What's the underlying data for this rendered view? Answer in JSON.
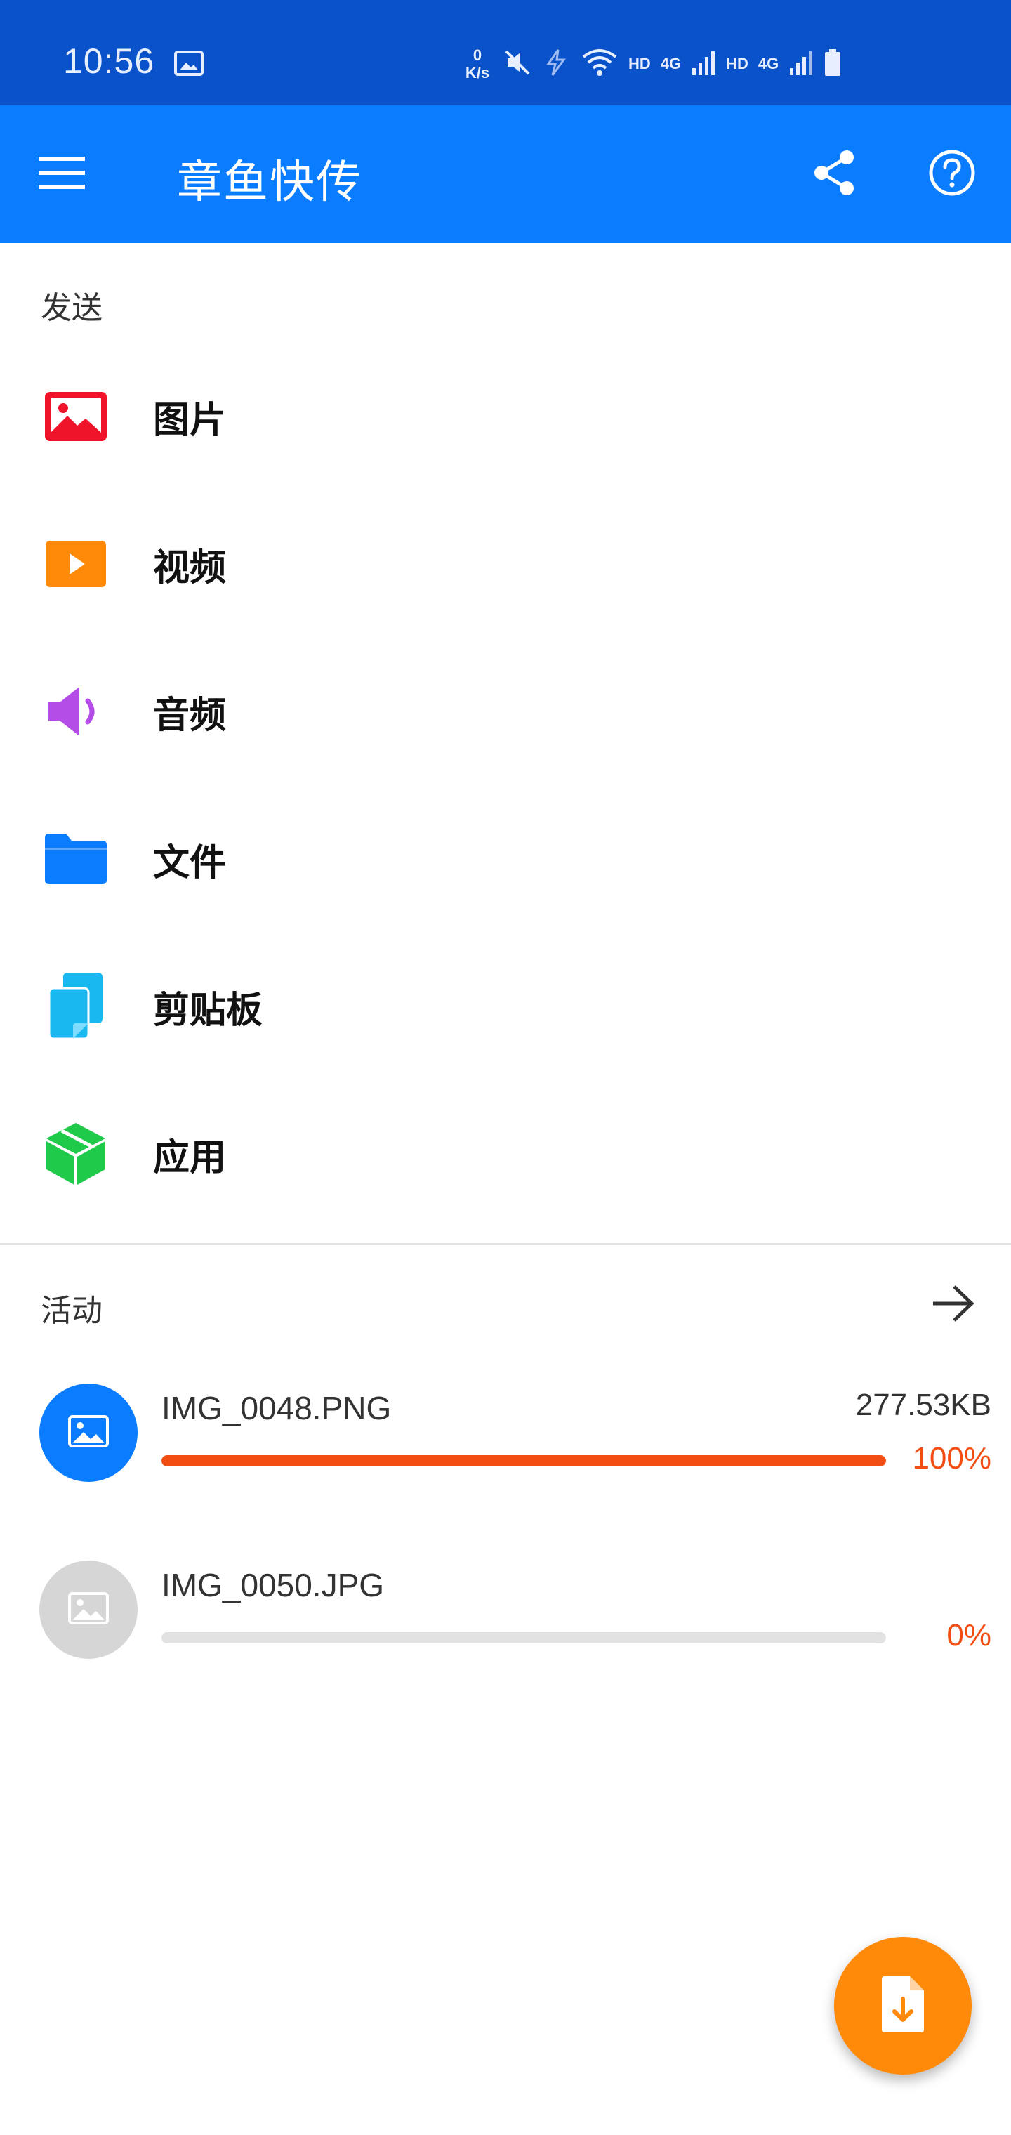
{
  "status_bar": {
    "time": "10:56",
    "net_speed_value": "0",
    "net_speed_unit": "K/s",
    "hd_1": "HD",
    "net_1": "4G",
    "hd_2": "HD",
    "net_2": "4G",
    "icons": [
      "image-icon",
      "mute-vibrate-icon",
      "no-charge-icon",
      "wifi-icon",
      "signal-icon",
      "signal-icon",
      "battery-icon"
    ]
  },
  "app_bar": {
    "title": "章鱼快传",
    "icons": [
      "menu-icon",
      "share-icon",
      "help-icon"
    ],
    "color": "#0a7cff"
  },
  "send": {
    "title": "发送",
    "items": [
      {
        "label": "图片",
        "icon": "image-icon",
        "color": "#f0142a"
      },
      {
        "label": "视频",
        "icon": "video-play-icon",
        "color": "#ff8a0a"
      },
      {
        "label": "音频",
        "icon": "speaker-icon",
        "color": "#b44ce8"
      },
      {
        "label": "文件",
        "icon": "folder-icon",
        "color": "#0a7cff"
      },
      {
        "label": "剪贴板",
        "icon": "clipboard-icon",
        "color": "#19b8f0"
      },
      {
        "label": "应用",
        "icon": "app-box-icon",
        "color": "#1fc94a"
      }
    ]
  },
  "activity": {
    "title": "活动",
    "arrow_icon": "arrow-right-icon",
    "transfers": [
      {
        "name": "IMG_0048.PNG",
        "size": "277.53KB",
        "percent": "100%",
        "progress": 1.0,
        "status_color": "#f24e14"
      },
      {
        "name": "IMG_0050.JPG",
        "size": "",
        "percent": "0%",
        "progress": 0.0,
        "status_color": "#f24e14"
      }
    ]
  },
  "fab": {
    "icon": "file-download-icon",
    "color": "#ff8a0a"
  }
}
